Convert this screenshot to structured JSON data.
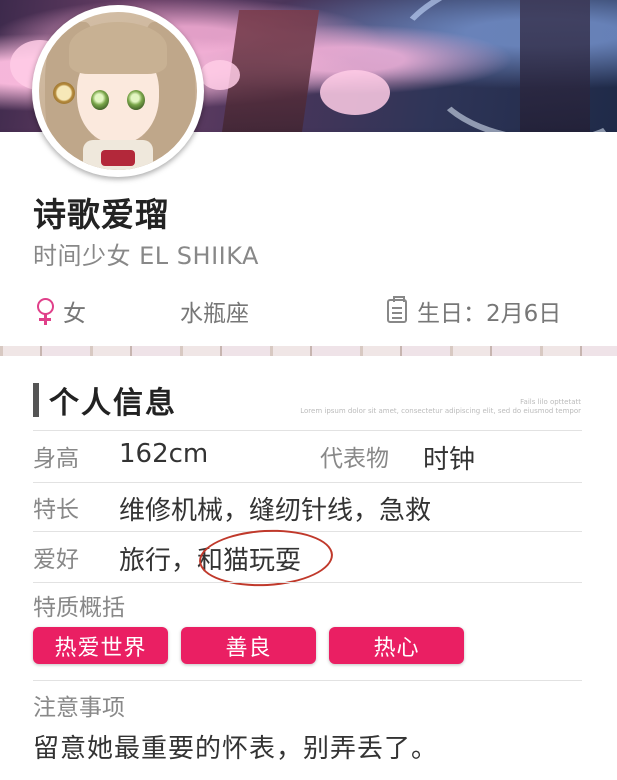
{
  "profile": {
    "name": "诗歌爱瑠",
    "subtitle": "时间少女  EL SHIIKA",
    "gender": "女",
    "zodiac": "水瓶座",
    "birthday": "生日：2月6日"
  },
  "info": {
    "section_title": "个人信息",
    "deco_text": "Fails lilo opttetatt\nLorem ipsum dolor sit amet, consectetur adipiscing elit, sed do eiusmod tempor",
    "height_label": "身高",
    "height_value": "162cm",
    "symbol_label": "代表物",
    "symbol_value": "时钟",
    "skill_label": "特长",
    "skill_value": "维修机械，缝纫针线，急救",
    "hobby_label": "爱好",
    "hobby_value": "旅行，和猫玩耍",
    "traits_label": "特质概括",
    "traits": [
      "热爱世界",
      "善良",
      "热心"
    ],
    "notes_label": "注意事项",
    "notes_value": "留意她最重要的怀表，别弄丢了。"
  },
  "colors": {
    "trait_bg": "#ea1f63",
    "gender_icon": "#e0408a",
    "annotation_circle": "#c0392b"
  },
  "icons": {
    "gender": "venus-icon",
    "birthday": "calendar-icon"
  }
}
